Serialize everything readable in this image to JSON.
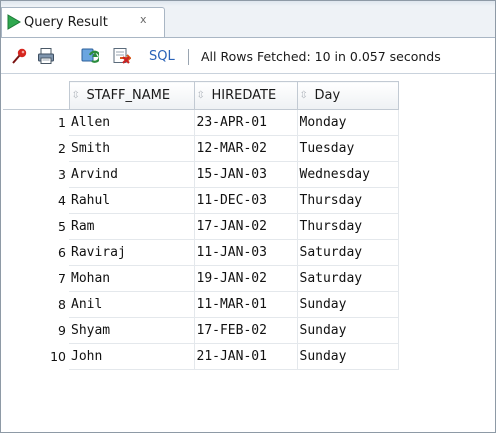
{
  "tab": {
    "title": "Query Result",
    "close_glyph": "x"
  },
  "toolbar": {
    "sql_label": "SQL",
    "status": "All Rows Fetched: 10 in 0.057 seconds",
    "icons": [
      "pin-icon",
      "print-icon",
      "refresh-icon",
      "export-icon"
    ]
  },
  "grid": {
    "columns": [
      "STAFF_NAME",
      "HIREDATE",
      "Day"
    ],
    "rows": [
      {
        "num": "1",
        "cells": [
          "Allen",
          "23-APR-01",
          "Monday"
        ]
      },
      {
        "num": "2",
        "cells": [
          "Smith",
          "12-MAR-02",
          "Tuesday"
        ]
      },
      {
        "num": "3",
        "cells": [
          "Arvind",
          "15-JAN-03",
          "Wednesday"
        ]
      },
      {
        "num": "4",
        "cells": [
          "Rahul",
          "11-DEC-03",
          "Thursday"
        ]
      },
      {
        "num": "5",
        "cells": [
          "Ram",
          "17-JAN-02",
          "Thursday"
        ]
      },
      {
        "num": "6",
        "cells": [
          "Raviraj",
          "11-JAN-03",
          "Saturday"
        ]
      },
      {
        "num": "7",
        "cells": [
          "Mohan",
          "19-JAN-02",
          "Saturday"
        ]
      },
      {
        "num": "8",
        "cells": [
          "Anil",
          "11-MAR-01",
          "Sunday"
        ]
      },
      {
        "num": "9",
        "cells": [
          "Shyam",
          "17-FEB-02",
          "Sunday"
        ]
      },
      {
        "num": "10",
        "cells": [
          "John",
          "21-JAN-01",
          "Sunday"
        ]
      }
    ]
  },
  "colors": {
    "accent_green": "#2fa84f",
    "link_blue": "#2a63b8",
    "border": "#c2cad3"
  }
}
